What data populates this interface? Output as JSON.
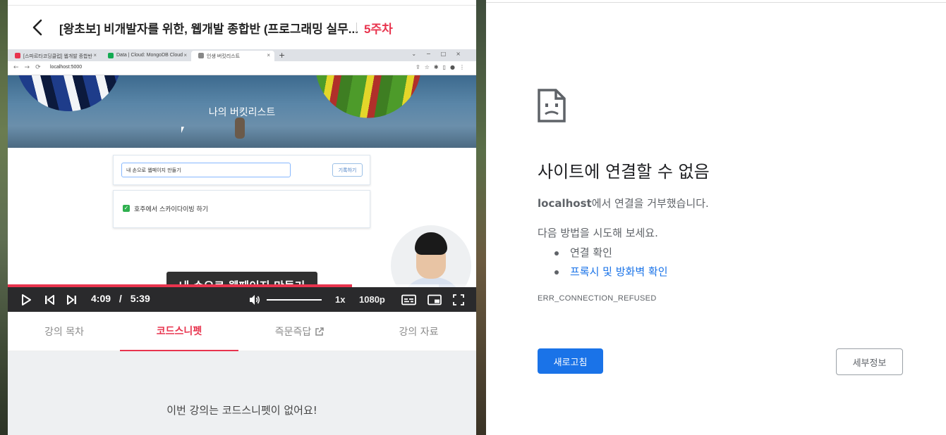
{
  "lecture": {
    "title": "[왕초보] 비개발자를 위한, 웹개발 종합반 (프로그래밍 실무...",
    "week": "5주차",
    "video": {
      "inner_browser": {
        "tabs": [
          {
            "label": "[스파르타코딩클럽] 웹개발 종합반",
            "favicon_color": "#e8344e"
          },
          {
            "label": "Data | Cloud: MongoDB Cloud",
            "favicon_color": "#13aa52"
          },
          {
            "label": "인생 버킷리스트",
            "favicon_color": "#888888"
          }
        ],
        "url": "localhost:5000",
        "hero_title": "나의 버킷리스트",
        "input_value": "내 손으로 웹페이지 만들기",
        "save_label": "기록하기",
        "todo_item": "호주에서 스카이다이빙 하기"
      },
      "subtitle": "내 손으로 웹페이지 만들기",
      "current_time": "4:09",
      "time_separator": "/",
      "duration": "5:39",
      "progress_fraction": 0.7345,
      "buffer_fraction": 0.92,
      "volume_fraction": 1.0,
      "speed": "1x",
      "quality": "1080p"
    },
    "tabs": [
      {
        "label": "강의 목차",
        "active": false
      },
      {
        "label": "코드스니펫",
        "active": true
      },
      {
        "label": "즉문즉답",
        "active": false,
        "external": true
      },
      {
        "label": "강의 자료",
        "active": false
      }
    ],
    "empty_message": "이번 강의는 코드스니펫이 없어요!"
  },
  "error_page": {
    "title": "사이트에 연결할 수 없음",
    "host": "localhost",
    "desc_suffix": "에서 연결을 거부했습니다.",
    "try_label": "다음 방법을 시도해 보세요.",
    "suggestions": [
      {
        "label": "연결 확인",
        "link": false
      },
      {
        "label": "프록시 및 방화벽 확인",
        "link": true
      }
    ],
    "error_code": "ERR_CONNECTION_REFUSED",
    "reload_label": "새로고침",
    "details_label": "세부정보"
  },
  "colors": {
    "accent_red": "#e8344e",
    "chrome_blue": "#1a73e8",
    "text_gray": "#5f6368"
  }
}
